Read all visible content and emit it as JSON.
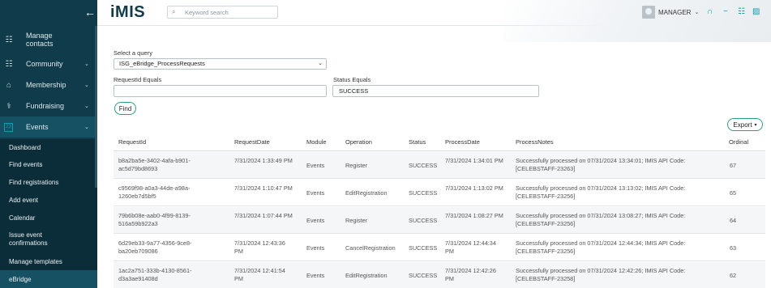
{
  "sidebar": {
    "manage_contacts": "Manage contacts",
    "items": [
      {
        "label": "Community"
      },
      {
        "label": "Membership"
      },
      {
        "label": "Fundraising"
      },
      {
        "label": "Events"
      }
    ],
    "sub_items": [
      {
        "label": "Dashboard"
      },
      {
        "label": "Find events"
      },
      {
        "label": "Find registrations"
      },
      {
        "label": "Add event"
      },
      {
        "label": "Calendar"
      },
      {
        "label": "Issue event confirmations"
      },
      {
        "label": "Manage templates"
      },
      {
        "label": "eBridge"
      }
    ]
  },
  "header": {
    "logo": "iMIS",
    "search_placeholder": "Keyword search",
    "user_name": "MANAGER"
  },
  "query": {
    "label": "Select a query",
    "value": "ISG_eBridge_ProcessRequests"
  },
  "filters": {
    "request_id_label": "RequestId Equals",
    "request_id_value": "",
    "status_label": "Status Equals",
    "status_value": "SUCCESS",
    "find_label": "Find",
    "export_label": "Export"
  },
  "table": {
    "headers": [
      "RequestId",
      "RequestDate",
      "Module",
      "Operation",
      "Status",
      "ProcessDate",
      "ProcessNotes",
      "Ordinal"
    ],
    "rows": [
      {
        "request_id": "b8a2ba5e-3402-4afa-b901-ac5d79bd8693",
        "request_date": "7/31/2024 1:33:49 PM",
        "module": "Events",
        "operation": "Register",
        "status": "SUCCESS",
        "process_date": "7/31/2024 1:34:01 PM",
        "notes": "Successfully processed on 07/31/2024 13:34:01; IMIS API Code: [CELEBSTAFF-23263]",
        "ordinal": "67"
      },
      {
        "request_id": "c9569f98-a0a3-44de-a98a-1260eb7d5bf5",
        "request_date": "7/31/2024 1:10:47 PM",
        "module": "Events",
        "operation": "EditRegistration",
        "status": "SUCCESS",
        "process_date": "7/31/2024 1:13:02 PM",
        "notes": "Successfully processed on 07/31/2024 13:13:02; IMIS API Code: [CELEBSTAFF-23256]",
        "ordinal": "65"
      },
      {
        "request_id": "79b6b08e-aab0-4f99-8139-516a59b922a3",
        "request_date": "7/31/2024 1:07:44 PM",
        "module": "Events",
        "operation": "Register",
        "status": "SUCCESS",
        "process_date": "7/31/2024 1:08:27 PM",
        "notes": "Successfully processed on 07/31/2024 13:08:27; IMIS API Code: [CELEBSTAFF-23256]",
        "ordinal": "64"
      },
      {
        "request_id": "6d29eb33-9a77-4356-9ce8-ba20eb709086",
        "request_date": "7/31/2024 12:43:36 PM",
        "module": "Events",
        "operation": "CancelRegistration",
        "status": "SUCCESS",
        "process_date": "7/31/2024 12:44:34 PM",
        "notes": "Successfully processed on 07/31/2024 12:44:34; IMIS API Code: [CELEBSTAFF-23256]",
        "ordinal": "63"
      },
      {
        "request_id": "1ac2a751-333b-4130-8561-d3a3ae91408d",
        "request_date": "7/31/2024 12:41:54 PM",
        "module": "Events",
        "operation": "EditRegistration",
        "status": "SUCCESS",
        "process_date": "7/31/2024 12:42:26 PM",
        "notes": "Successfully processed on 07/31/2024 12:42:26; IMIS API Code: [CELEBSTAFF-23258]",
        "ordinal": "62"
      }
    ]
  },
  "colors": {
    "sidebar": "#0f3b4a",
    "accent": "#2aa37a",
    "icon_accent": "#0a9fb0"
  },
  "icons": [
    "back-arrow-icon",
    "search-icon",
    "headset-icon",
    "minus-icon",
    "cart-icon",
    "chart-icon"
  ]
}
